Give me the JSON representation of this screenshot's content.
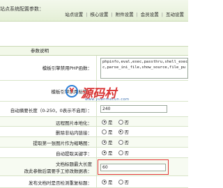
{
  "window": {
    "title": "站点系统配置参数："
  },
  "tabs": [
    {
      "label": "站点设置"
    },
    {
      "label": "核心设置"
    },
    {
      "label": "附件设置"
    },
    {
      "label": "会员设置"
    },
    {
      "label": "互动设置"
    }
  ],
  "tab_separator": "|",
  "table": {
    "header": "参数说明",
    "rows": {
      "forbidden_functions": {
        "label": "模板引擎禁用PHP函数：",
        "value": "phpinfo,eval,exec,passthru,shell_exec,\nc,parse_ini_file,show_source,file_pu"
      },
      "forbidden_tags": {
        "label": "模板引擎禁用标签："
      },
      "auto_summary_length": {
        "label": "自动摘要长度（0-250，0表示不启用）：",
        "value": "240"
      },
      "remote_image_local": {
        "label": "远程图片本地化：",
        "options": [
          "是",
          "否"
        ],
        "selected": 0
      },
      "remove_site_links": {
        "label": "删除非站内链接：",
        "options": [
          "是",
          "否"
        ],
        "selected": 1
      },
      "first_image_thumb": {
        "label": "提取第一张图片作为缩略图：",
        "options": [
          "是",
          "否"
        ],
        "selected": 0
      },
      "auto_keywords": {
        "label": "自动提取关键字：",
        "options": [
          "是",
          "否"
        ],
        "selected": 0
      },
      "title_max_length": {
        "label_line1": "文档标题最大长度",
        "label_line2": "改此参数后需要手工修改数据表：",
        "value": "60"
      },
      "check_duplicate_title": {
        "label": "发布文档时是否检测重复标题：",
        "options": [
          "是",
          "否"
        ],
        "selected": 0
      }
    }
  },
  "watermark": {
    "logo": "Y",
    "title": "源码村",
    "subtitle": "www.yuanmacun.com"
  },
  "colors": {
    "header_bg": "#e4efd6",
    "row_border": "#d8e4c9",
    "highlight_border": "#e23434",
    "watermark_red": "#d93535",
    "watermark_blue": "#2b7fd6"
  }
}
